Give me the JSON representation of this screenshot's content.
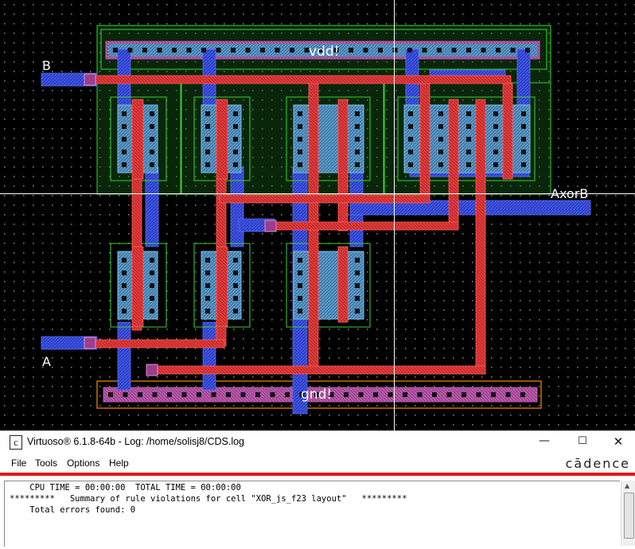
{
  "layout_view": {
    "labels": {
      "vdd": "vdd!",
      "gnd": "gnd!",
      "input_b": "B",
      "input_a": "A",
      "output": "AxorB"
    },
    "colors": {
      "background": "#000000",
      "metal1": "#3b4fd8",
      "poly": "#e0302a",
      "nwell": "#3ad43a",
      "contact": "#c84fc0",
      "active": "#5aa0c8",
      "crosshair": "#ffffff",
      "gnd_boundary": "#ff8c00"
    }
  },
  "log_window": {
    "title": "Virtuoso® 6.1.8-64b - Log: /home/solisj8/CDS.log",
    "app_icon_letter": "c",
    "brand": "cādence",
    "window_buttons": {
      "minimize": "—",
      "maximize": "☐",
      "close": "✕"
    },
    "menu": [
      "File",
      "Tools",
      "Options",
      "Help"
    ],
    "lines": [
      "    CPU TIME = 00:00:00  TOTAL TIME = 00:00:00",
      "*********   Summary of rule violations for cell \"XOR_js_f23 layout\"   *********",
      "    Total errors found: 0"
    ]
  }
}
